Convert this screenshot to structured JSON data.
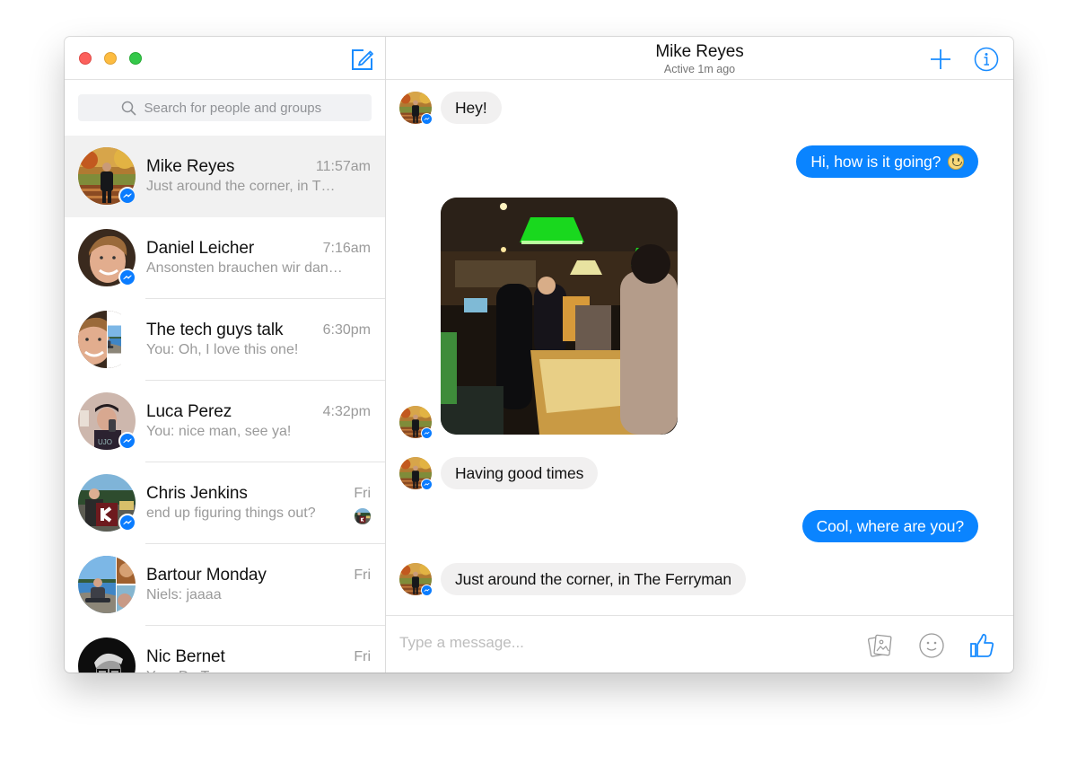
{
  "window": {
    "controls": [
      "close",
      "minimize",
      "maximize"
    ]
  },
  "sidebar": {
    "compose_icon": "compose-icon",
    "search": {
      "icon": "search-icon",
      "placeholder": "Search for people and groups",
      "value": ""
    },
    "conversations": [
      {
        "name": "Mike Reyes",
        "time": "11:57am",
        "preview": "Just around the corner, in T…",
        "active": true,
        "messenger_badge": true
      },
      {
        "name": "Daniel Leicher",
        "time": "7:16am",
        "preview": "Ansonsten brauchen wir dann …",
        "active": false,
        "messenger_badge": true
      },
      {
        "name": "The tech guys talk",
        "time": "6:30pm",
        "preview": "You: Oh, I love this one!",
        "active": false,
        "messenger_badge": false,
        "group": true
      },
      {
        "name": "Luca Perez",
        "time": "4:32pm",
        "preview": "You: nice man, see ya!",
        "active": false,
        "messenger_badge": true
      },
      {
        "name": "Chris Jenkins",
        "time": "Fri",
        "preview": "end up figuring things out?",
        "active": false,
        "messenger_badge": true,
        "seen_avatar": true
      },
      {
        "name": "Bartour Monday",
        "time": "Fri",
        "preview": "Niels: jaaaa",
        "active": false,
        "messenger_badge": false,
        "group": true
      },
      {
        "name": "Nic Bernet",
        "time": "Fri",
        "preview": "You: Do T… ",
        "active": false,
        "messenger_badge": false
      }
    ]
  },
  "chat": {
    "title": "Mike Reyes",
    "status": "Active 1m ago",
    "header_icons": [
      "add-icon",
      "info-icon"
    ],
    "messages": [
      {
        "from": "them",
        "type": "text",
        "text": "Hey!"
      },
      {
        "from": "me",
        "type": "text",
        "text": "Hi, how is it going?",
        "emoji": "smiley"
      },
      {
        "from": "them",
        "type": "photo",
        "description": "Pub interior with green lamps"
      },
      {
        "from": "them",
        "type": "text",
        "text": "Having good times"
      },
      {
        "from": "me",
        "type": "text",
        "text": "Cool, where are you?"
      },
      {
        "from": "them",
        "type": "text",
        "text": "Just around the corner, in The Ferryman"
      }
    ],
    "composer": {
      "placeholder": "Type a message...",
      "value": "",
      "icons": [
        "photo-icon",
        "emoji-icon",
        "like-icon"
      ]
    }
  },
  "colors": {
    "accent": "#0a84ff",
    "messenger_badge": "#0a7cff",
    "incoming_bubble": "#f1f0f0",
    "active_row": "#f1f1f1"
  }
}
